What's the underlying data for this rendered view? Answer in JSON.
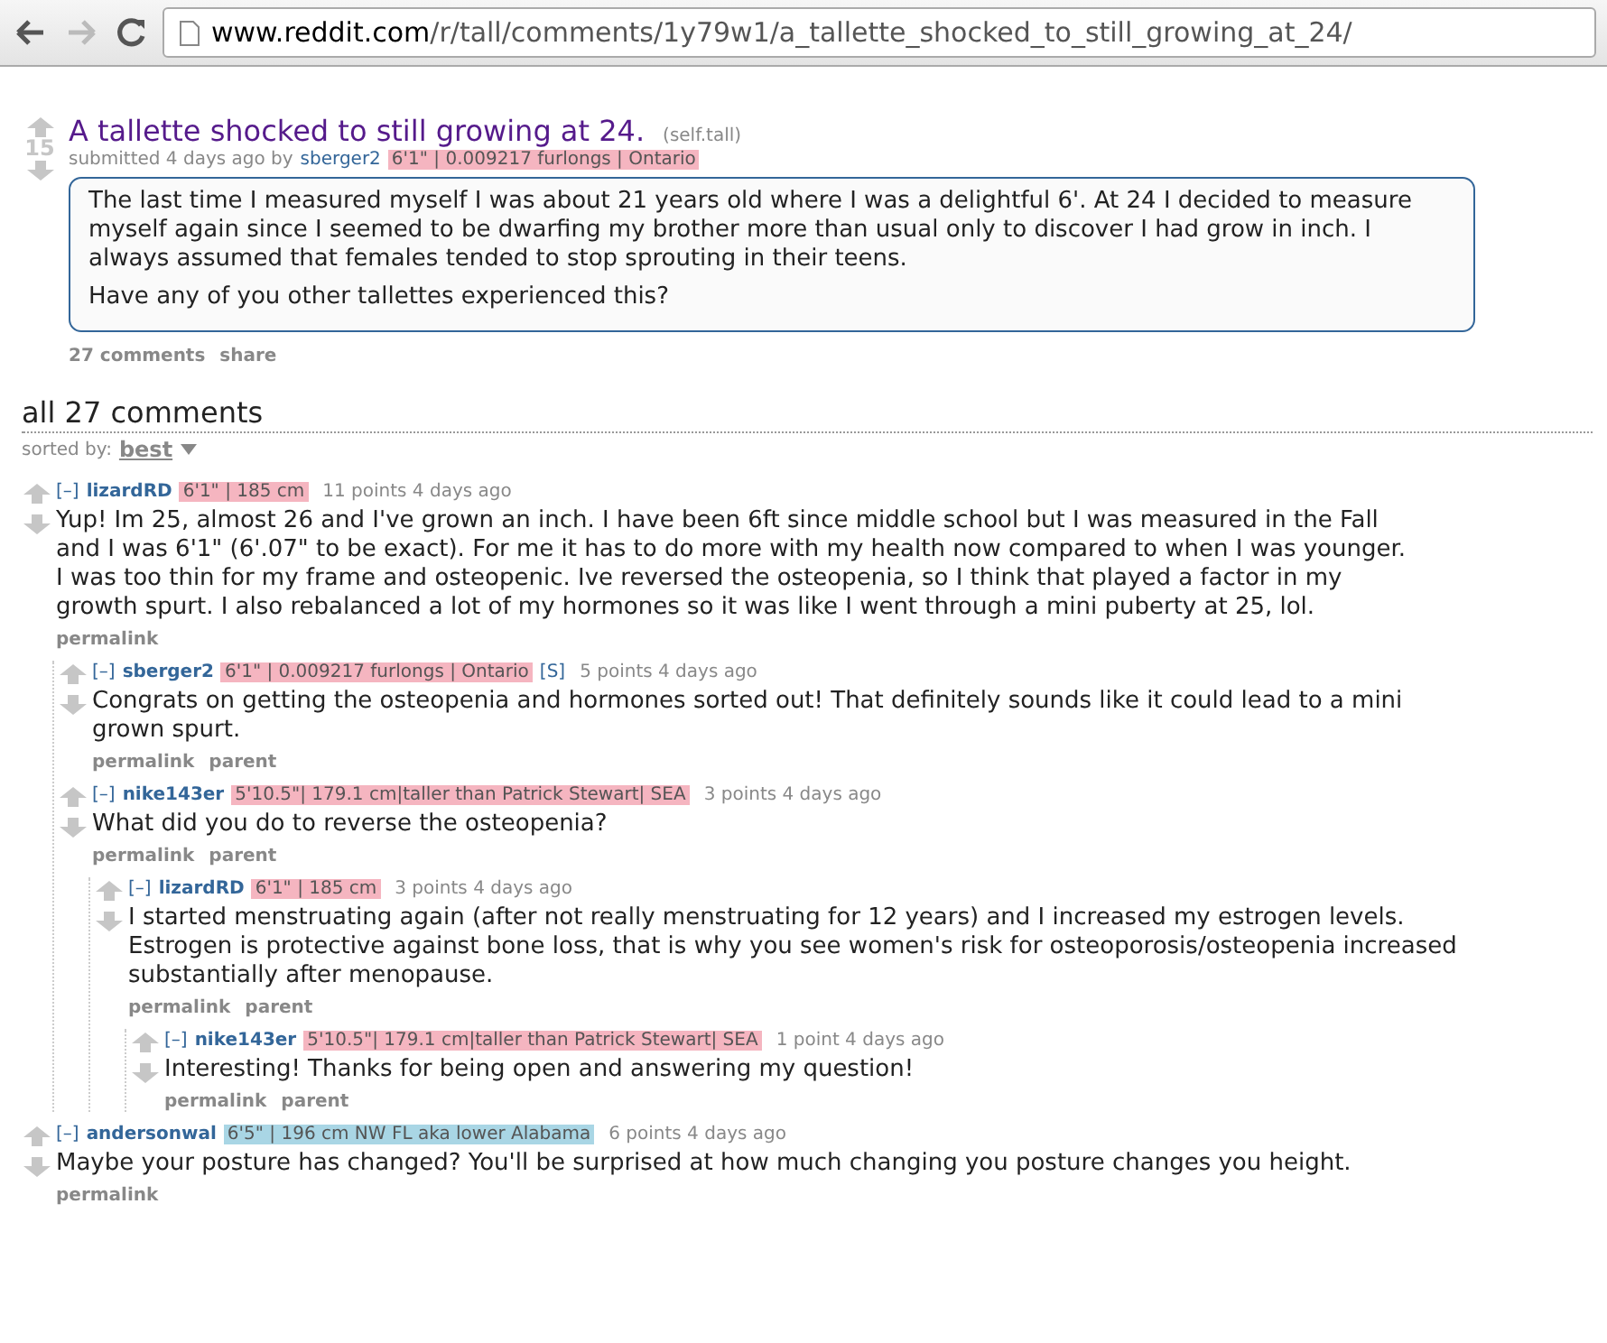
{
  "browser": {
    "url_host": "www.reddit.com",
    "url_path": "/r/tall/comments/1y79w1/a_tallette_shocked_to_still_growing_at_24/"
  },
  "post": {
    "title": "A tallette shocked to still growing at 24.",
    "domain": "(self.tall)",
    "score": "15",
    "submitted": "submitted 4 days ago by",
    "author": "sberger2",
    "flair": "6'1\" | 0.009217 furlongs | Ontario",
    "color": "#f5b5c0",
    "body": [
      "The last time I measured myself I was about 21 years old where I was a delightful 6'. At 24 I decided to measure myself again since I seemed to be dwarfing my brother more than usual only to discover I had grow in inch. I always assumed that females tended to stop sprouting in their teens.",
      "Have any of you other tallettes experienced this?"
    ],
    "links": [
      "27 comments",
      "share"
    ]
  },
  "comments_header": {
    "title": "all 27 comments",
    "sort_label": "sorted by:",
    "sort_value": "best"
  },
  "comments": [
    {
      "toggle": "[–]",
      "author": "lizardRD",
      "flair": "6'1\" | 185 cm",
      "color": "#f5b5c0",
      "score": "11 points 4 days ago",
      "body": "Yup! Im 25, almost 26 and I've grown an inch. I have been 6ft since middle school but I was measured in the Fall and I was 6'1\" (6'.07\" to be exact). For me it has to do more with my health now compared to when I was younger. I was too thin for my frame and osteopenic. Ive reversed the osteopenia, so I think that played a factor in my growth spurt. I also rebalanced a lot of my hormones so it was like I went through a mini puberty at 25, lol.",
      "links": [
        "permalink"
      ],
      "children": [
        {
          "toggle": "[–]",
          "author": "sberger2",
          "flair": "6'1\" | 0.009217 furlongs | Ontario",
          "color": "#f5b5c0",
          "op_mark": "[S]",
          "score": "5 points 4 days ago",
          "body": "Congrats on getting the osteopenia and hormones sorted out! That definitely sounds like it could lead to a mini grown spurt.",
          "links": [
            "permalink",
            "parent"
          ]
        },
        {
          "toggle": "[–]",
          "author": "nike143er",
          "flair": "5'10.5\"| 179.1 cm|taller than Patrick Stewart| SEA",
          "color": "#f5b5c0",
          "score": "3 points 4 days ago",
          "body": "What did you do to reverse the osteopenia?",
          "links": [
            "permalink",
            "parent"
          ],
          "children": [
            {
              "toggle": "[–]",
              "author": "lizardRD",
              "flair": "6'1\" | 185 cm",
              "color": "#f5b5c0",
              "score": "3 points 4 days ago",
              "body": "I started menstruating again (after not really menstruating for 12 years) and I increased my estrogen levels. Estrogen is protective against bone loss, that is why you see women's risk for osteoporosis/osteopenia increased substantially after menopause.",
              "links": [
                "permalink",
                "parent"
              ],
              "children": [
                {
                  "toggle": "[–]",
                  "author": "nike143er",
                  "flair": "5'10.5\"| 179.1 cm|taller than Patrick Stewart| SEA",
                  "color": "#f5b5c0",
                  "score": "1 point 4 days ago",
                  "body": "Interesting! Thanks for being open and answering my question!",
                  "links": [
                    "permalink",
                    "parent"
                  ]
                }
              ]
            }
          ]
        }
      ]
    },
    {
      "toggle": "[–]",
      "author": "andersonwal",
      "flair": "6'5\" | 196 cm NW FL aka lower Alabama",
      "color": "#a9d6e5",
      "score": "6 points 4 days ago",
      "body": "Maybe your posture has changed? You'll be surprised at how much changing you posture changes you height.",
      "links": [
        "permalink"
      ]
    }
  ]
}
